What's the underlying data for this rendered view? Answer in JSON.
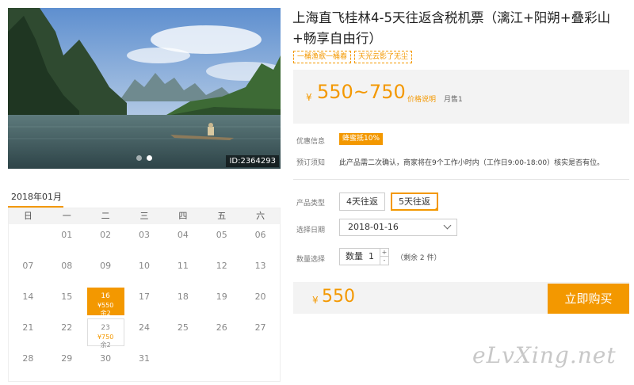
{
  "hero": {
    "id_label": "ID:2364293",
    "alt": "Li River karst mountains with fisherman on bamboo raft"
  },
  "calendar": {
    "month": "2018年01月",
    "weekdays": [
      "日",
      "一",
      "二",
      "三",
      "四",
      "五",
      "六"
    ],
    "days": [
      {
        "day": ""
      },
      {
        "day": "01"
      },
      {
        "day": "02"
      },
      {
        "day": "03"
      },
      {
        "day": "04"
      },
      {
        "day": "05"
      },
      {
        "day": "06"
      },
      {
        "day": "07"
      },
      {
        "day": "08"
      },
      {
        "day": "09"
      },
      {
        "day": "10"
      },
      {
        "day": "11"
      },
      {
        "day": "12"
      },
      {
        "day": "13"
      },
      {
        "day": "14"
      },
      {
        "day": "15"
      },
      {
        "day": "16",
        "price": "¥550",
        "remain": "余2",
        "state": "selected"
      },
      {
        "day": "17"
      },
      {
        "day": "18"
      },
      {
        "day": "19"
      },
      {
        "day": "20"
      },
      {
        "day": "21"
      },
      {
        "day": "22"
      },
      {
        "day": "23",
        "price": "¥750",
        "remain": "余2",
        "state": "available"
      },
      {
        "day": "24"
      },
      {
        "day": "25"
      },
      {
        "day": "26"
      },
      {
        "day": "27"
      },
      {
        "day": "28"
      },
      {
        "day": "29"
      },
      {
        "day": "30"
      },
      {
        "day": "31"
      },
      {
        "day": ""
      },
      {
        "day": ""
      },
      {
        "day": ""
      }
    ]
  },
  "product": {
    "title": "上海直飞桂林4-5天往返含税机票（漓江+阳朔+叠彩山+畅享自由行）",
    "tags": [
      "一桶渔歌一桶春",
      "天光云影了无尘"
    ],
    "price_currency": "¥",
    "price_range": "550~750",
    "price_note": "价格说明",
    "monthly_sales": "月售1",
    "promo_label": "优惠信息",
    "promo_badge": "蜂蜜抵10%",
    "notice_label": "预订须知",
    "notice_text": "此产品需二次确认，商家将在9个工作小时内（工作日9:00-18:00）核实是否有位。",
    "type_label": "产品类型",
    "type_options": [
      "4天往返",
      "5天往返"
    ],
    "type_selected_index": 1,
    "date_label": "选择日期",
    "date_value": "2018-01-16",
    "qty_label": "数量选择",
    "qty_prefix": "数量",
    "qty_value": "1",
    "qty_plus": "+",
    "qty_minus": "-",
    "remaining": "（剩余 2 件）",
    "total_currency": "¥",
    "total_amount": "550",
    "buy_label": "立即购买"
  },
  "watermark": "eLvXing.net",
  "colors": {
    "accent": "#f39800",
    "panel": "#f3f3f3"
  }
}
